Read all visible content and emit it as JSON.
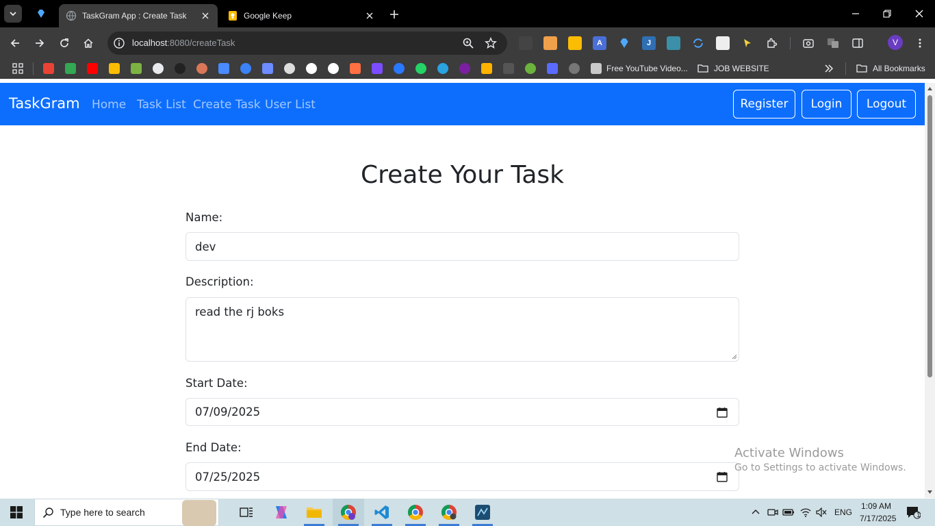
{
  "browser": {
    "tabs": [
      {
        "title": "TaskGram App : Create Task",
        "active": true
      },
      {
        "title": "Google Keep",
        "active": false
      }
    ],
    "address": {
      "host": "localhost",
      "path": ":8080/createTask"
    },
    "bookmarks": {
      "folder_label_1": "Free YouTube Video...",
      "folder_label_2": "JOB WEBSITE",
      "all_bookmarks": "All Bookmarks"
    },
    "profile_initial": "V"
  },
  "navbar": {
    "brand": "TaskGram",
    "links": [
      "Home",
      "Task List",
      "Create Task",
      "User List"
    ],
    "buttons": [
      "Register",
      "Login",
      "Logout"
    ]
  },
  "form": {
    "heading": "Create Your Task",
    "name_label": "Name:",
    "name_value": "dev",
    "description_label": "Description:",
    "description_value": "read the rj boks",
    "start_date_label": "Start Date:",
    "start_date_value": "07/09/2025",
    "end_date_label": "End Date:",
    "end_date_value": "07/25/2025"
  },
  "watermark": {
    "line1": "Activate Windows",
    "line2": "Go to Settings to activate Windows."
  },
  "taskbar": {
    "search_placeholder": "Type here to search",
    "language": "ENG",
    "time": "1:09 AM",
    "date": "7/17/2025",
    "notification_count": "1"
  },
  "colors": {
    "navbar": "#0d6efd",
    "browser_frame": "#000000",
    "toolbar": "#3c3c3c",
    "taskbar": "#cfe0e6"
  }
}
